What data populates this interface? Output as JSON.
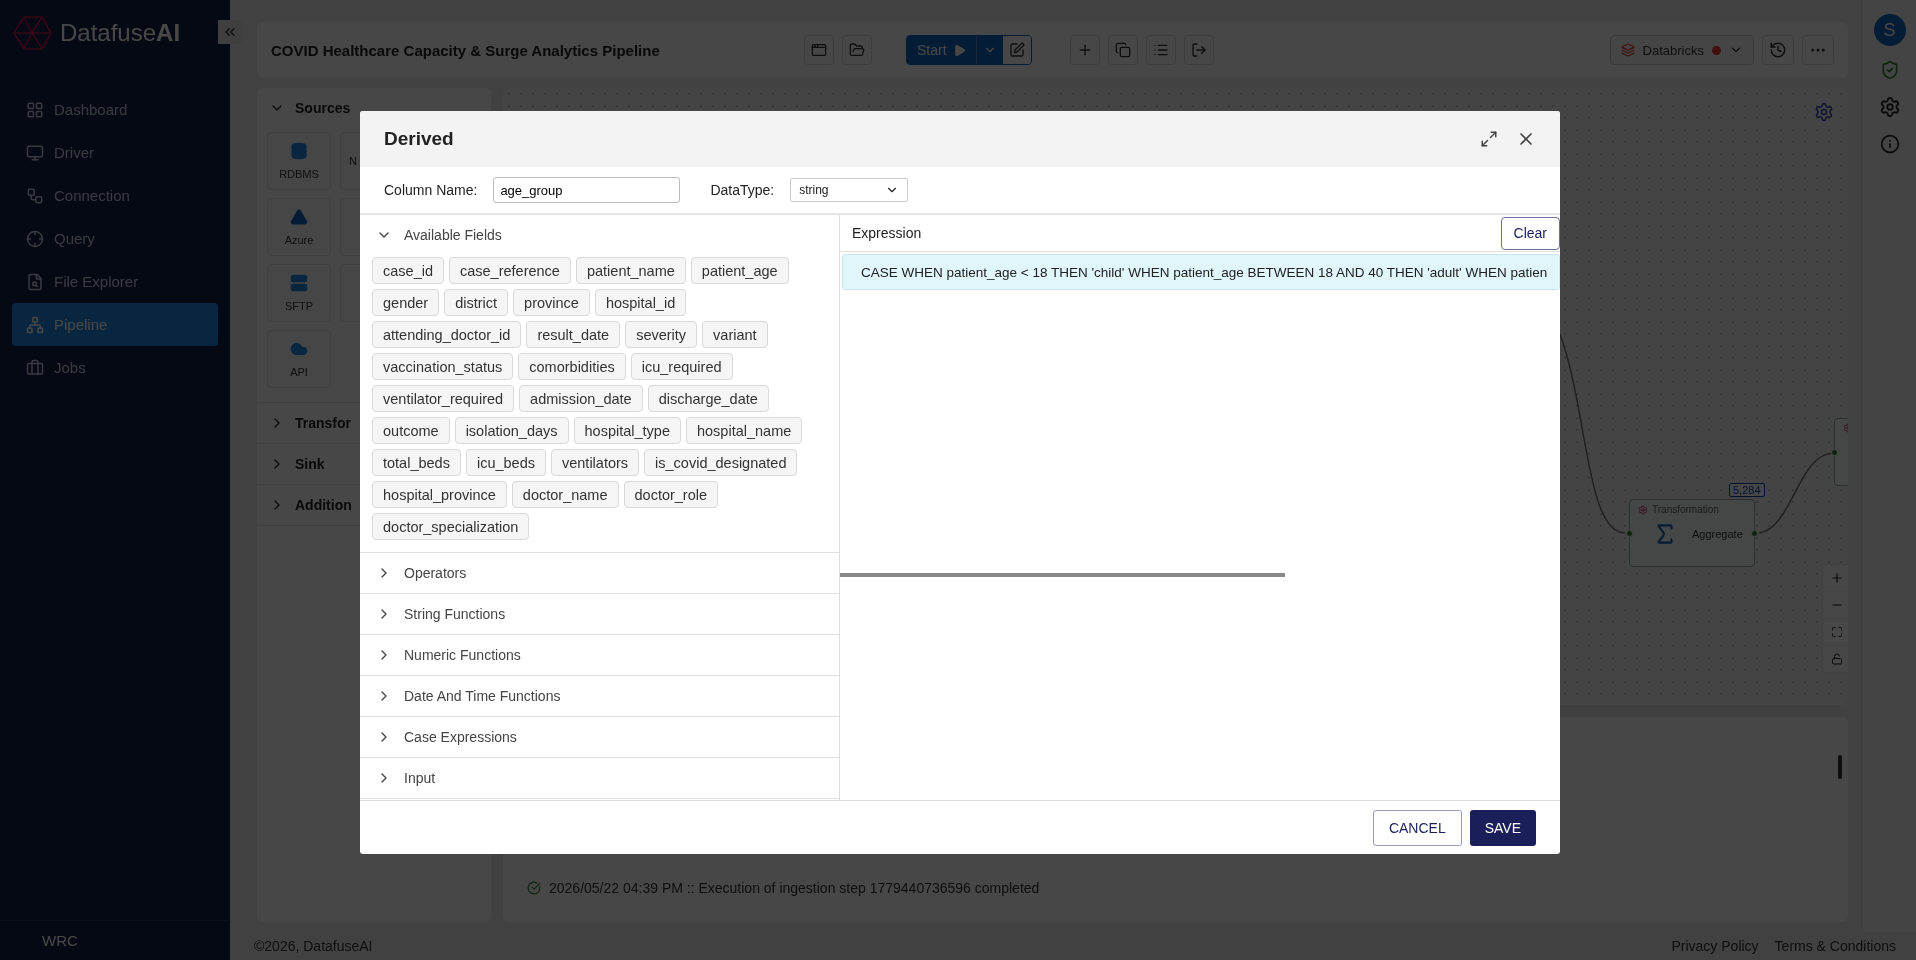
{
  "sidebar": {
    "brand": "Datafuse**AI**",
    "items": [
      {
        "label": "Dashboard",
        "selected": false
      },
      {
        "label": "Driver",
        "selected": false
      },
      {
        "label": "Connection",
        "selected": false
      },
      {
        "label": "Query",
        "selected": false
      },
      {
        "label": "File Explorer",
        "selected": false
      },
      {
        "label": "Pipeline",
        "selected": true
      },
      {
        "label": "Jobs",
        "selected": false
      }
    ],
    "footer": "WRC"
  },
  "header": {
    "title": "COVID Healthcare Capacity & Surge Analytics Pipeline",
    "start": "Start",
    "engine": "Databricks"
  },
  "palette": {
    "sections": [
      {
        "title": "Sources",
        "expanded": true,
        "tiles": [
          {
            "kind": "tile",
            "label": "RDBMS"
          },
          {
            "kind": "partial",
            "label": "N"
          },
          {
            "kind": "tile",
            "label": "Azure"
          },
          {
            "kind": "blank"
          },
          {
            "kind": "tile",
            "label": "SFTP"
          },
          {
            "kind": "blank"
          },
          {
            "kind": "tile",
            "label": "API"
          }
        ]
      },
      {
        "title": "Transfor",
        "expanded": false
      },
      {
        "title": "Sink",
        "expanded": false
      },
      {
        "title": "Addition",
        "expanded": false
      }
    ]
  },
  "canvas": {
    "nodes": [
      {
        "category": "Transformation",
        "label": "Aggregate",
        "badge": "5,284"
      }
    ]
  },
  "log": [
    "2026/05/22 04:39 PM :: Execution of ingestion step 1779440736596 completed"
  ],
  "rail": {
    "avatar": "S"
  },
  "footer": {
    "copyright": "©2026, DatafuseAI",
    "links": [
      "Privacy Policy",
      "Terms & Conditions"
    ]
  },
  "dialog": {
    "title": "Derived",
    "column_name": {
      "label": "Column Name:",
      "value": "age_group"
    },
    "datatype": {
      "label": "DataType:",
      "value": "string"
    },
    "sections": [
      {
        "title": "Available Fields",
        "expanded": true,
        "fields": [
          "case_id",
          "case_reference",
          "patient_name",
          "patient_age",
          "gender",
          "district",
          "province",
          "hospital_id",
          "attending_doctor_id",
          "result_date",
          "severity",
          "variant",
          "vaccination_status",
          "comorbidities",
          "icu_required",
          "ventilator_required",
          "admission_date",
          "discharge_date",
          "outcome",
          "isolation_days",
          "hospital_type",
          "hospital_name",
          "total_beds",
          "icu_beds",
          "ventilators",
          "is_covid_designated",
          "hospital_province",
          "doctor_name",
          "doctor_role",
          "doctor_specialization"
        ]
      },
      {
        "title": "Operators",
        "expanded": false
      },
      {
        "title": "String Functions",
        "expanded": false
      },
      {
        "title": "Numeric Functions",
        "expanded": false
      },
      {
        "title": "Date And Time Functions",
        "expanded": false
      },
      {
        "title": "Case Expressions",
        "expanded": false
      },
      {
        "title": "Input",
        "expanded": false
      }
    ],
    "expression": {
      "label": "Expression",
      "value": "CASE WHEN patient_age < 18 THEN 'child' WHEN patient_age BETWEEN 18 AND 40 THEN 'adult' WHEN patien"
    },
    "clear": "Clear",
    "cancel": "CANCEL",
    "save": "SAVE"
  }
}
